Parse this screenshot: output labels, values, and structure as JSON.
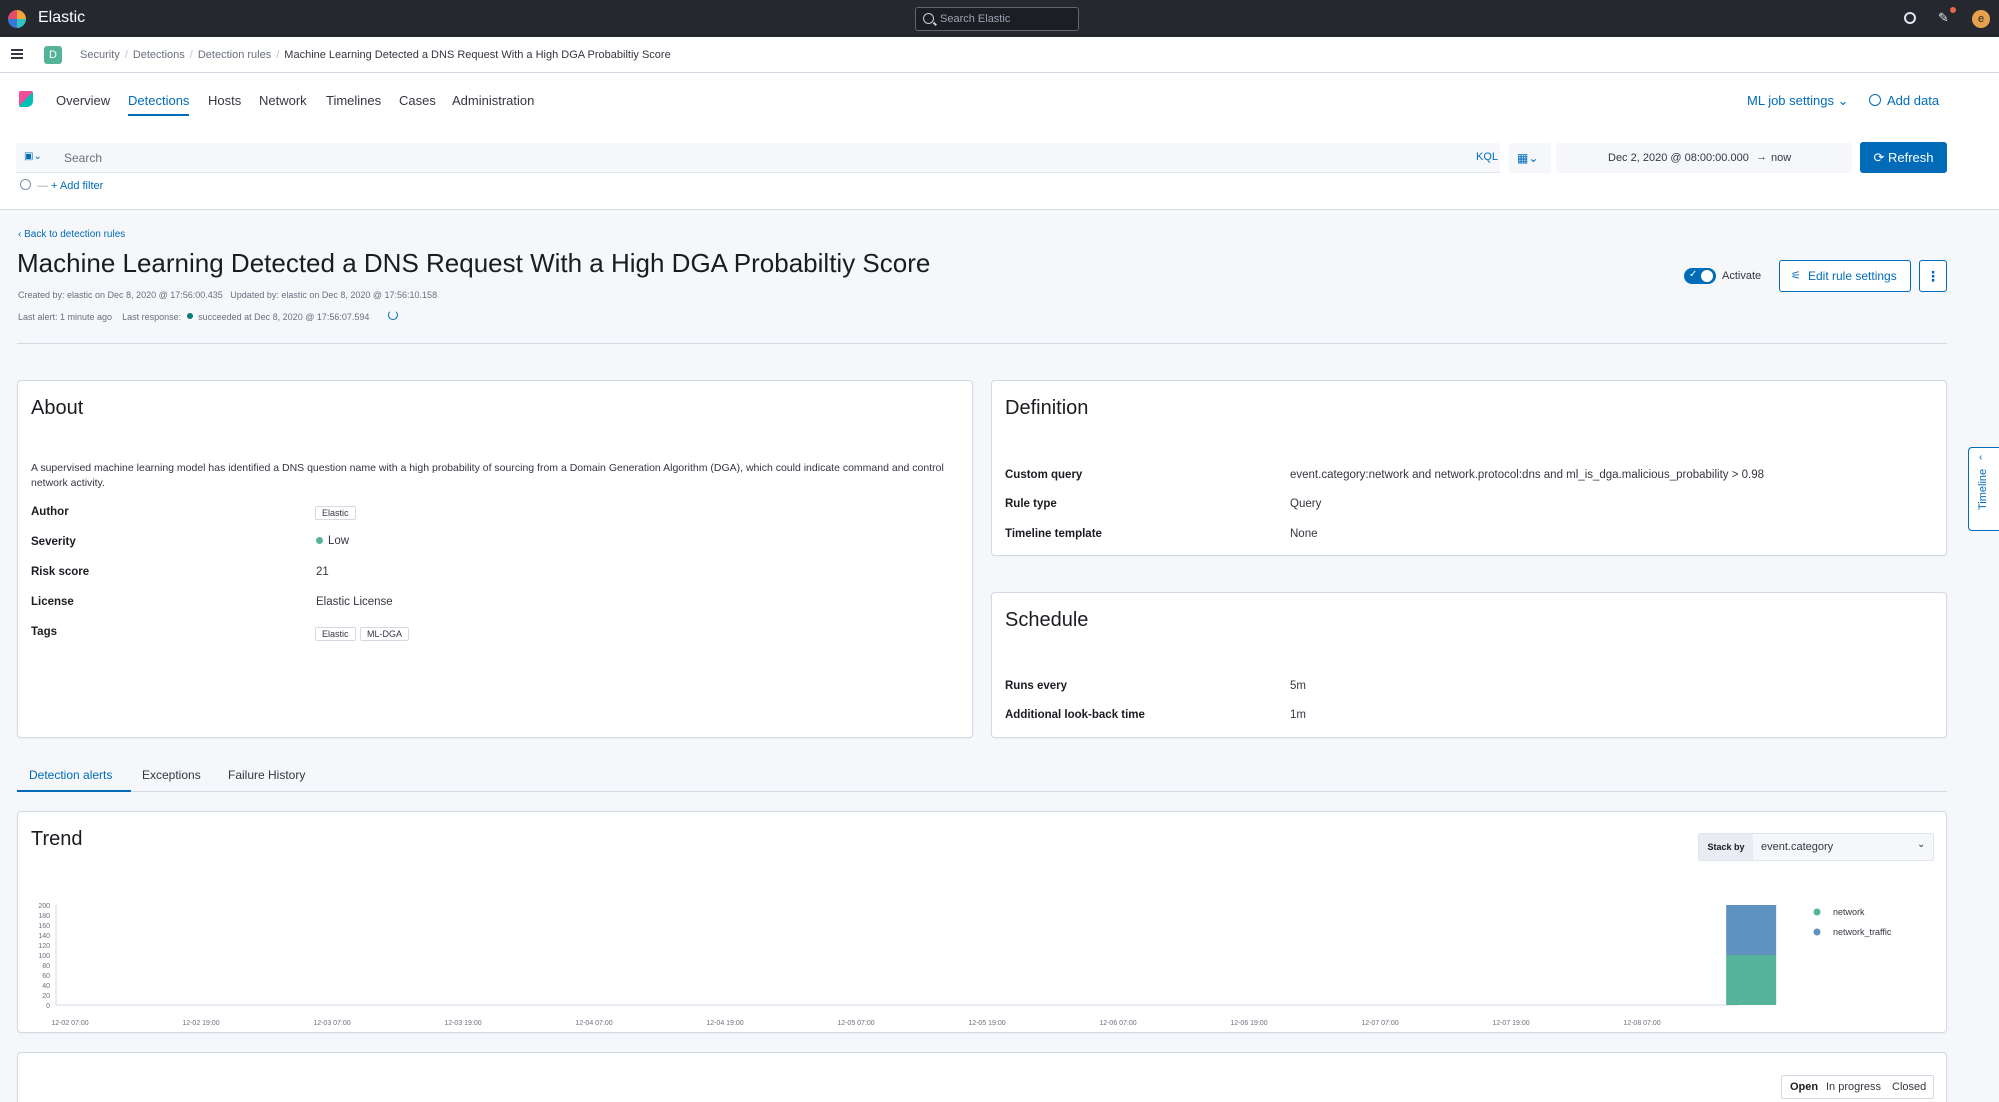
{
  "header": {
    "brand": "Elastic",
    "search_placeholder": "Search Elastic",
    "avatar_initial": "e"
  },
  "breadcrumbs": {
    "space": "D",
    "items": [
      "Security",
      "Detections",
      "Detection rules",
      "Machine Learning Detected a DNS Request With a High DGA Probabiltiy Score"
    ]
  },
  "nav": {
    "tabs": [
      "Overview",
      "Detections",
      "Hosts",
      "Network",
      "Timelines",
      "Cases",
      "Administration"
    ],
    "active": "Detections",
    "ml_job_settings": "ML job settings",
    "add_data": "Add data"
  },
  "query": {
    "placeholder": "Search",
    "language": "KQL",
    "date_from": "Dec 2, 2020 @ 08:00:00.000",
    "date_arrow": "→",
    "date_to": "now",
    "refresh_label": "Refresh",
    "add_filter": "+ Add filter"
  },
  "rule": {
    "back_link": "Back to detection rules",
    "title": "Machine Learning Detected a DNS Request With a High DGA Probabiltiy Score",
    "created": "Created by: elastic on Dec 8, 2020 @ 17:56:00.435",
    "updated": "Updated by: elastic on Dec 8, 2020 @ 17:56:10.158",
    "last_alert": "Last alert: 1 minute ago",
    "last_response_label": "Last response:",
    "last_response_value": "succeeded at Dec 8, 2020 @ 17:56:07.594",
    "activate_label": "Activate",
    "activated": true,
    "edit_label": "Edit rule settings"
  },
  "about": {
    "heading": "About",
    "description": "A supervised machine learning model has identified a DNS question name with a high probability of sourcing from a Domain Generation Algorithm (DGA), which could indicate command and control network activity.",
    "fields": {
      "author_label": "Author",
      "author": "Elastic",
      "severity_label": "Severity",
      "severity": "Low",
      "risk_label": "Risk score",
      "risk": "21",
      "license_label": "License",
      "license": "Elastic License",
      "tags_label": "Tags",
      "tags": [
        "Elastic",
        "ML-DGA"
      ]
    }
  },
  "definition": {
    "heading": "Definition",
    "query_label": "Custom query",
    "query": "event.category:network and network.protocol:dns and ml_is_dga.malicious_probability > 0.98",
    "type_label": "Rule type",
    "type": "Query",
    "timeline_label": "Timeline template",
    "timeline": "None"
  },
  "schedule": {
    "heading": "Schedule",
    "runs_label": "Runs every",
    "runs": "5m",
    "lookback_label": "Additional look-back time",
    "lookback": "1m"
  },
  "detail_tabs": {
    "items": [
      "Detection alerts",
      "Exceptions",
      "Failure History"
    ],
    "active": "Detection alerts"
  },
  "trend": {
    "heading": "Trend",
    "stack_by_label": "Stack by",
    "stack_by_value": "event.category"
  },
  "chart_data": {
    "type": "bar",
    "stacked": true,
    "ylim": [
      0,
      200
    ],
    "yticks": [
      0,
      20,
      40,
      60,
      80,
      100,
      120,
      140,
      160,
      180,
      200
    ],
    "xticks": [
      "12-02 07:00",
      "12-02 19:00",
      "12-03 07:00",
      "12-03 19:00",
      "12-04 07:00",
      "12-04 19:00",
      "12-05 07:00",
      "12-05 19:00",
      "12-06 07:00",
      "12-06 19:00",
      "12-07 07:00",
      "12-07 19:00",
      "12-08 07:00"
    ],
    "bar_position": "12-08 17:00",
    "series": [
      {
        "name": "network",
        "color": "#54b399",
        "value": 100
      },
      {
        "name": "network_traffic",
        "color": "#6092c0",
        "value": 100
      }
    ],
    "legend": "top-right"
  },
  "alerts_filter": {
    "options": [
      "Open",
      "In progress",
      "Closed"
    ],
    "active": "Open"
  },
  "timeline_flyout": {
    "label": "Timeline"
  }
}
